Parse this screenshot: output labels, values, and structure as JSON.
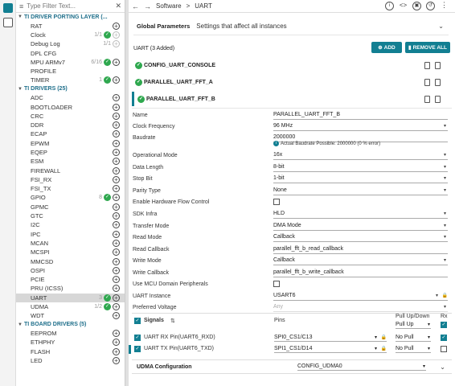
{
  "filter": {
    "placeholder": "Type Filter Text..."
  },
  "tree": {
    "porting": {
      "title": "TI DRIVER PORTING LAYER (...",
      "items": [
        {
          "label": "RAT",
          "count": "",
          "state": "plus"
        },
        {
          "label": "Clock",
          "count": "1/1",
          "state": "check-dim"
        },
        {
          "label": "Debug Log",
          "count": "1/1",
          "state": "dim"
        },
        {
          "label": "DPL CFG",
          "count": "",
          "state": "none"
        },
        {
          "label": "MPU ARMv7",
          "count": "6/16",
          "state": "check"
        },
        {
          "label": "PROFILE",
          "count": "",
          "state": "none"
        },
        {
          "label": "TIMER",
          "count": "1",
          "state": "check"
        }
      ]
    },
    "drivers": {
      "title": "TI DRIVERS (25)",
      "items": [
        {
          "label": "ADC",
          "count": "",
          "state": "plus"
        },
        {
          "label": "BOOTLOADER",
          "count": "",
          "state": "plus"
        },
        {
          "label": "CRC",
          "count": "",
          "state": "plus"
        },
        {
          "label": "DDR",
          "count": "",
          "state": "plus"
        },
        {
          "label": "ECAP",
          "count": "",
          "state": "plus"
        },
        {
          "label": "EPWM",
          "count": "",
          "state": "plus"
        },
        {
          "label": "EQEP",
          "count": "",
          "state": "plus"
        },
        {
          "label": "ESM",
          "count": "",
          "state": "plus"
        },
        {
          "label": "FIREWALL",
          "count": "",
          "state": "plus"
        },
        {
          "label": "FSI_RX",
          "count": "",
          "state": "plus"
        },
        {
          "label": "FSI_TX",
          "count": "",
          "state": "plus"
        },
        {
          "label": "GPIO",
          "count": "8",
          "state": "check"
        },
        {
          "label": "GPMC",
          "count": "",
          "state": "plus"
        },
        {
          "label": "GTC",
          "count": "",
          "state": "plus"
        },
        {
          "label": "I2C",
          "count": "",
          "state": "plus"
        },
        {
          "label": "IPC",
          "count": "",
          "state": "plus"
        },
        {
          "label": "MCAN",
          "count": "",
          "state": "plus"
        },
        {
          "label": "MCSPI",
          "count": "",
          "state": "plus"
        },
        {
          "label": "MMCSD",
          "count": "",
          "state": "plus"
        },
        {
          "label": "OSPI",
          "count": "",
          "state": "plus"
        },
        {
          "label": "PCIE",
          "count": "",
          "state": "plus"
        },
        {
          "label": "PRU (ICSS)",
          "count": "",
          "state": "plus"
        },
        {
          "label": "UART",
          "count": "3",
          "state": "check",
          "selected": true
        },
        {
          "label": "UDMA",
          "count": "1/2",
          "state": "check"
        },
        {
          "label": "WDT",
          "count": "",
          "state": "plus"
        }
      ]
    },
    "board": {
      "title": "TI BOARD DRIVERS (5)",
      "items": [
        {
          "label": "EEPROM",
          "count": "",
          "state": "plus"
        },
        {
          "label": "ETHPHY",
          "count": "",
          "state": "plus"
        },
        {
          "label": "FLASH",
          "count": "",
          "state": "plus"
        },
        {
          "label": "LED",
          "count": "",
          "state": "plus"
        }
      ]
    }
  },
  "breadcrumb": {
    "part1": "Software",
    "sep": ">",
    "part2": "UART"
  },
  "global": {
    "title": "Global Parameters",
    "desc": "Settings that affect all instances"
  },
  "uart": {
    "header": "UART (3 Added)",
    "add_label": "ADD",
    "remove_label": "REMOVE ALL",
    "instances": [
      "CONFIG_UART_CONSOLE",
      "PARALLEL_UART_FFT_A",
      "PARALLEL_UART_FFT_B"
    ]
  },
  "props": [
    {
      "k": "Name",
      "v": "PARALLEL_UART_FFT_B",
      "type": "text"
    },
    {
      "k": "Clock Frequency",
      "v": "96 MHz",
      "type": "select"
    },
    {
      "k": "Baudrate",
      "v": "2000000",
      "type": "text"
    },
    {
      "k": "Operational Mode",
      "v": "16x",
      "type": "select"
    },
    {
      "k": "Data Length",
      "v": "8-bit",
      "type": "select"
    },
    {
      "k": "Stop Bit",
      "v": "1-bit",
      "type": "select"
    },
    {
      "k": "Parity Type",
      "v": "None",
      "type": "select"
    },
    {
      "k": "Enable Hardware Flow Control",
      "v": "",
      "type": "checkbox"
    },
    {
      "k": "SDK Infra",
      "v": "HLD",
      "type": "select"
    },
    {
      "k": "Transfer Mode",
      "v": "DMA Mode",
      "type": "select"
    },
    {
      "k": "Read Mode",
      "v": "Callback",
      "type": "select"
    },
    {
      "k": "Read Callback",
      "v": "parallel_fft_b_read_callback",
      "type": "text"
    },
    {
      "k": "Write Mode",
      "v": "Callback",
      "type": "select"
    },
    {
      "k": "Write Callback",
      "v": "parallel_fft_b_write_callback",
      "type": "text"
    },
    {
      "k": "Use MCU Domain Peripherals",
      "v": "",
      "type": "checkbox"
    },
    {
      "k": "UART Instance",
      "v": "USART6",
      "type": "select-lock"
    },
    {
      "k": "Preferred Voltage",
      "v": "Any",
      "type": "select-dis"
    }
  ],
  "baud_note": "Actual Baudrate Possible: 2000000 (0 % error)",
  "signals": {
    "header": "Signals",
    "pins_header": "Pins",
    "pull_header": "Pull Up/Down",
    "pull_value": "Pull Up",
    "rx_header": "Rx",
    "rows": [
      {
        "label": "UART RX Pin(UART6_RXD)",
        "pin": "SPI0_CS1/C13",
        "pull": "No Pull"
      },
      {
        "label": "UART TX Pin(UART6_TXD)",
        "pin": "SPI1_CS1/D14",
        "pull": "No Pull"
      }
    ]
  },
  "udma": {
    "label": "UDMA Configuration",
    "value": "CONFIG_UDMA0"
  },
  "colors": {
    "accent": "#127f92",
    "check": "#2fa84f"
  }
}
